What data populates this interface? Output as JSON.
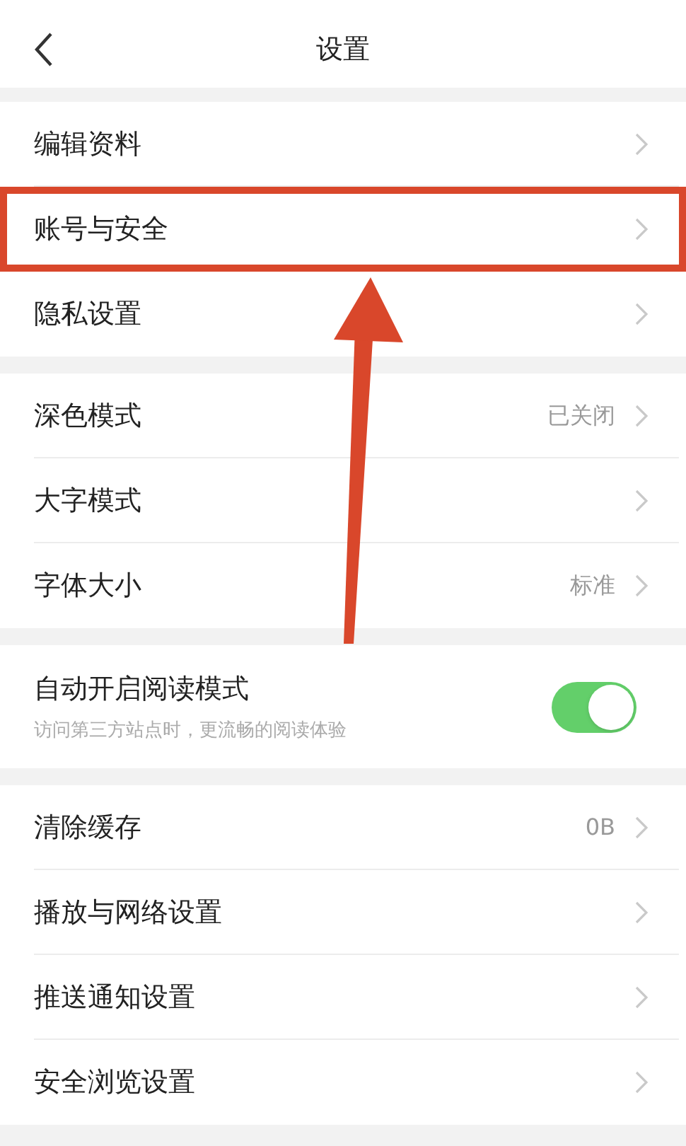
{
  "header": {
    "title": "设置"
  },
  "groups": [
    {
      "items": [
        {
          "kind": "link",
          "label": "编辑资料",
          "highlighted": false
        },
        {
          "kind": "link",
          "label": "账号与安全",
          "highlighted": true
        },
        {
          "kind": "link",
          "label": "隐私设置",
          "highlighted": false
        }
      ]
    },
    {
      "items": [
        {
          "kind": "link",
          "label": "深色模式",
          "value": "已关闭",
          "highlighted": false
        },
        {
          "kind": "link",
          "label": "大字模式",
          "highlighted": false
        },
        {
          "kind": "link",
          "label": "字体大小",
          "value": "标准",
          "highlighted": false
        }
      ]
    },
    {
      "items": [
        {
          "kind": "toggle",
          "label": "自动开启阅读模式",
          "subtitle": "访问第三方站点时，更流畅的阅读体验",
          "on": true,
          "highlighted": false
        }
      ]
    },
    {
      "items": [
        {
          "kind": "link",
          "label": "清除缓存",
          "value": "0B",
          "highlighted": false
        },
        {
          "kind": "link",
          "label": "播放与网络设置",
          "highlighted": false
        },
        {
          "kind": "link",
          "label": "推送通知设置",
          "highlighted": false
        },
        {
          "kind": "link",
          "label": "安全浏览设置",
          "highlighted": false
        }
      ]
    }
  ]
}
